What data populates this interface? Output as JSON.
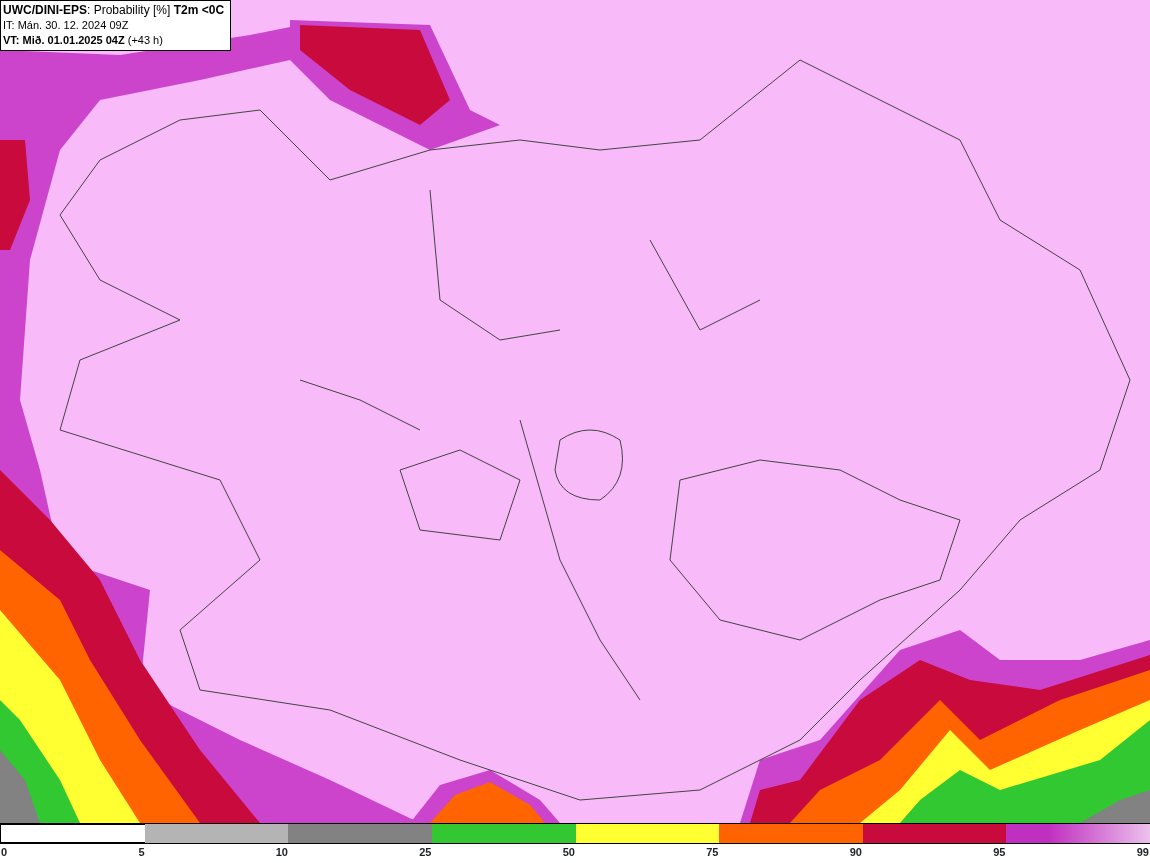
{
  "header": {
    "lines": [
      "**UWC/DINI-EPS**: Probability [%] **T2m <0C**",
      "IT: Mán. 30. 12. 2024 09Z",
      "**VT: Mið. 01.01.2025 04Z** (+43 h)"
    ]
  },
  "legend": {
    "segments": [
      {
        "color": "#ffffff"
      },
      {
        "color": "#b4b4b4"
      },
      {
        "color": "#828282"
      },
      {
        "color": "#32c832"
      },
      {
        "color": "#ffff32"
      },
      {
        "color": "#ff6400"
      },
      {
        "color": "#c80a3c"
      },
      {
        "color": "#c030c0",
        "kind": "gradient"
      }
    ],
    "labels": [
      "0",
      "5",
      "10",
      "25",
      "50",
      "75",
      "90",
      "95",
      "99"
    ]
  }
}
